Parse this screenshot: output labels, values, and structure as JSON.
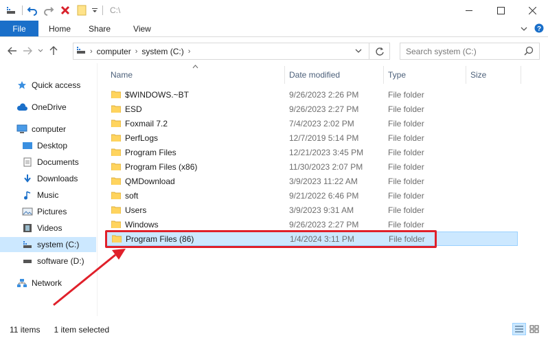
{
  "titlebar": {
    "path": "C:\\"
  },
  "ribbon": {
    "tabs": [
      "File",
      "Home",
      "Share",
      "View"
    ]
  },
  "address": {
    "crumbs": [
      "computer",
      "system (C:)"
    ]
  },
  "search": {
    "placeholder": "Search system (C:)"
  },
  "nav": {
    "items": [
      {
        "label": "Quick access"
      },
      {
        "label": "OneDrive"
      },
      {
        "label": "computer"
      },
      {
        "label": "Desktop"
      },
      {
        "label": "Documents"
      },
      {
        "label": "Downloads"
      },
      {
        "label": "Music"
      },
      {
        "label": "Pictures"
      },
      {
        "label": "Videos"
      },
      {
        "label": "system (C:)"
      },
      {
        "label": "software (D:)"
      },
      {
        "label": "Network"
      }
    ]
  },
  "columns": {
    "name": "Name",
    "date": "Date modified",
    "type": "Type",
    "size": "Size"
  },
  "files": [
    {
      "name": "$WINDOWS.~BT",
      "date": "9/26/2023 2:26 PM",
      "type": "File folder"
    },
    {
      "name": "ESD",
      "date": "9/26/2023 2:27 PM",
      "type": "File folder"
    },
    {
      "name": "Foxmail 7.2",
      "date": "7/4/2023 2:02 PM",
      "type": "File folder"
    },
    {
      "name": "PerfLogs",
      "date": "12/7/2019 5:14 PM",
      "type": "File folder"
    },
    {
      "name": "Program Files",
      "date": "12/21/2023 3:45 PM",
      "type": "File folder"
    },
    {
      "name": "Program Files (x86)",
      "date": "11/30/2023 2:07 PM",
      "type": "File folder"
    },
    {
      "name": "QMDownload",
      "date": "3/9/2023 11:22 AM",
      "type": "File folder"
    },
    {
      "name": "soft",
      "date": "9/21/2022 6:46 PM",
      "type": "File folder"
    },
    {
      "name": "Users",
      "date": "3/9/2023 9:31 AM",
      "type": "File folder"
    },
    {
      "name": "Windows",
      "date": "9/26/2023 2:27 PM",
      "type": "File folder"
    },
    {
      "name": "Program Files (86)",
      "date": "1/4/2024 3:11 PM",
      "type": "File folder"
    }
  ],
  "status": {
    "count": "11 items",
    "selected": "1 item selected"
  },
  "colors": {
    "accent": "#1a6fc9",
    "selection": "#cce8ff",
    "annotation": "#e0202a"
  }
}
